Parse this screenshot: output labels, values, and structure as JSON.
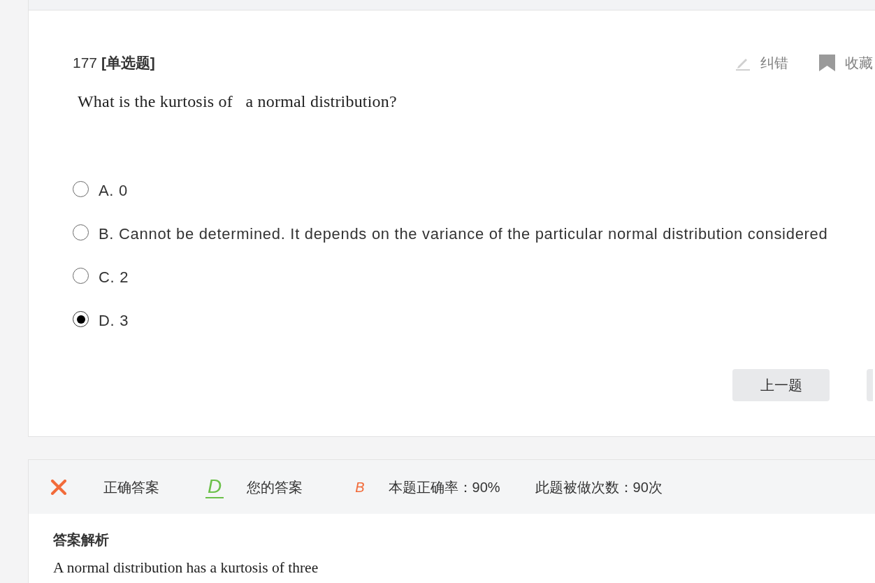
{
  "question": {
    "heading": "177 **[单选题]**",
    "actions": [
      {
        "kind": "report",
        "label": "纠错"
      },
      {
        "kind": "favorite",
        "label": "收藏"
      }
    ],
    "text": "What is the kurtosis of   a normal distribution?",
    "options": [
      {
        "label": "A. 0",
        "selected": false
      },
      {
        "label": "B. Cannot be determined. It depends on the variance of the particular normal distribution considered",
        "selected": false
      },
      {
        "label": "C. 2",
        "selected": false
      },
      {
        "label": "D. 3",
        "selected": true
      }
    ],
    "buttons": [
      {
        "kind": "text",
        "label": "上一题"
      },
      {
        "kind": "edge"
      }
    ]
  },
  "result": {
    "correct": false,
    "correct_answer_label": "正确答案",
    "correct_answer": "D",
    "your_answer_label": "您的答案",
    "your_answer": "B",
    "accuracy": "本题正确率：90%",
    "attempts": "此题被做次数：90次"
  },
  "explanation": {
    "title": "答案解析",
    "text": "A normal distribution has a kurtosis of three"
  }
}
